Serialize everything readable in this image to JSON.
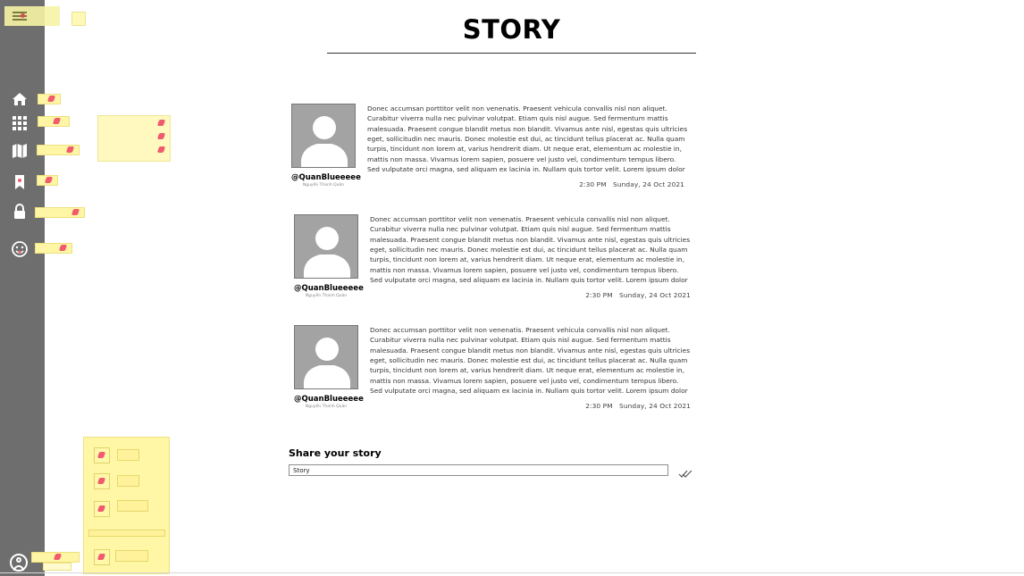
{
  "header": {
    "title": "STORY"
  },
  "posts": [
    {
      "handle": "@QuanBlueeeee",
      "fullname": "Nguyễn Thanh Quân",
      "text": "Donec accumsan porttitor velit non venenatis. Praesent vehicula convallis nisl non aliquet. Curabitur viverra nulla nec pulvinar volutpat. Etiam quis nisl augue. Sed fermentum mattis malesuada. Praesent congue blandit metus non blandit. Vivamus ante nisl, egestas quis ultricies eget, sollicitudin nec mauris. Donec molestie est dui, ac tincidunt tellus placerat ac. Nulla quam turpis, tincidunt non lorem at, varius hendrerit diam. Ut neque erat, elementum ac molestie in, mattis non massa. Vivamus lorem sapien, posuere vel justo vel, condimentum tempus libero. Sed vulputate orci magna, sed aliquam ex lacinia in. Nullam quis tortor velit. Lorem ipsum dolor",
      "time": "2:30 PM",
      "date": "Sunday, 24 Oct 2021"
    },
    {
      "handle": "@QuanBlueeeee",
      "fullname": "Nguyễn Thanh Quân",
      "text": "Donec accumsan porttitor velit non venenatis. Praesent vehicula convallis nisl non aliquet. Curabitur viverra nulla nec pulvinar volutpat. Etiam quis nisl augue. Sed fermentum mattis malesuada. Praesent congue blandit metus non blandit. Vivamus ante nisl, egestas quis ultricies eget, sollicitudin nec mauris. Donec molestie est dui, ac tincidunt tellus placerat ac. Nulla quam turpis, tincidunt non lorem at, varius hendrerit diam. Ut neque erat, elementum ac molestie in, mattis non massa. Vivamus lorem sapien, posuere vel justo vel, condimentum tempus libero. Sed vulputate orci magna, sed aliquam ex lacinia in. Nullam quis tortor velit. Lorem ipsum dolor",
      "time": "2:30 PM",
      "date": "Sunday, 24 Oct 2021"
    },
    {
      "handle": "@QuanBlueeeee",
      "fullname": "Nguyễn Thanh Quân",
      "text": "Donec accumsan porttitor velit non venenatis. Praesent vehicula convallis nisl non aliquet. Curabitur viverra nulla nec pulvinar volutpat. Etiam quis nisl augue. Sed fermentum mattis malesuada. Praesent congue blandit metus non blandit. Vivamus ante nisl, egestas quis ultricies eget, sollicitudin nec mauris. Donec molestie est dui, ac tincidunt tellus placerat ac. Nulla quam turpis, tincidunt non lorem at, varius hendrerit diam. Ut neque erat, elementum ac molestie in, mattis non massa. Vivamus lorem sapien, posuere vel justo vel, condimentum tempus libero. Sed vulputate orci magna, sed aliquam ex lacinia in. Nullam quis tortor velit. Lorem ipsum dolor",
      "time": "2:30 PM",
      "date": "Sunday, 24 Oct 2021"
    }
  ],
  "share": {
    "title": "Share your story",
    "input_value": "Story"
  },
  "icons": {
    "menu": "hamburger-icon",
    "home": "home-icon",
    "apps": "grid-icon",
    "map": "map-icon",
    "bookmark": "bookmark-icon",
    "lock": "lock-icon",
    "emoji": "emoji-icon",
    "user": "user-icon",
    "send": "double-check-icon"
  },
  "colors": {
    "rail": "#6e6e6e",
    "highlight": "#fff6a5",
    "accent": "#f05b6e"
  }
}
